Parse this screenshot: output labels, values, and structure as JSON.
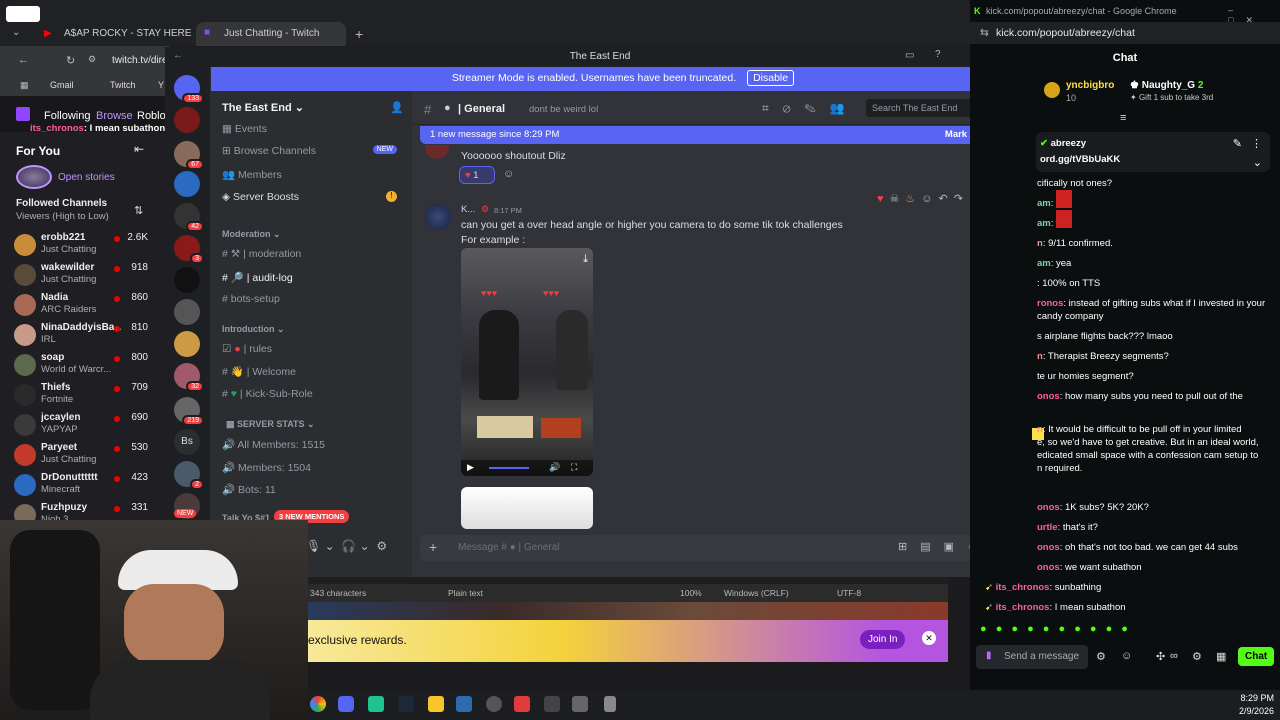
{
  "twitch_browser": {
    "tabs": [
      {
        "label": "A$AP ROCKY - STAY HERE 4 LIF"
      },
      {
        "label": "Just Chatting - Twitch"
      }
    ],
    "url": "twitch.tv/dire",
    "bookmarks": [
      "Gmail",
      "Twitch",
      "Y"
    ],
    "nav": {
      "following": "Following",
      "browse": "Browse",
      "roblox": "Roblo"
    },
    "chat_overlay": {
      "user": "its_chronos",
      "text": ": I mean subathon"
    }
  },
  "twitch_sidebar": {
    "title": "For You",
    "open_stories": "Open stories",
    "followed_title": "Followed Channels",
    "followed_sub": "Viewers (High to Low)",
    "channels": [
      {
        "name": "erobb221",
        "game": "Just Chatting",
        "viewers": "2.6K",
        "color": "#c98c3a"
      },
      {
        "name": "wakewilder",
        "game": "Just Chatting",
        "viewers": "918",
        "color": "#5a4a3a"
      },
      {
        "name": "Nadia",
        "game": "ARC Raiders",
        "viewers": "860",
        "color": "#a86a55"
      },
      {
        "name": "NinaDaddyisBa...",
        "game": "IRL",
        "viewers": "810",
        "color": "#c79a8a"
      },
      {
        "name": "soap",
        "game": "World of Warcr...",
        "viewers": "800",
        "color": "#5a6a4a"
      },
      {
        "name": "Thiefs",
        "game": "Fortnite",
        "viewers": "709",
        "color": "#2a2a2a"
      },
      {
        "name": "jccaylen",
        "game": "YAPYAP",
        "viewers": "690",
        "color": "#3a3a3a"
      },
      {
        "name": "Paryeet",
        "game": "Just Chatting",
        "viewers": "530",
        "color": "#c33a2a"
      },
      {
        "name": "DrDonutttttt",
        "game": "Minecraft",
        "viewers": "423",
        "color": "#2a6ac0"
      },
      {
        "name": "Fuzhpuzy",
        "game": "Nioh 3",
        "viewers": "331",
        "color": "#7a6a5a"
      }
    ]
  },
  "discord": {
    "window_title": "The East End",
    "banner_text": "Streamer Mode is enabled. Usernames have been truncated.",
    "banner_button": "Disable",
    "server_name": "The East End",
    "guild_badges": [
      "133",
      "67",
      "42",
      "3",
      "32",
      "219",
      "2"
    ],
    "guild_bs": "Bs",
    "guild_new": "NEW",
    "channels_top": [
      {
        "label": "Events"
      },
      {
        "label": "Browse Channels",
        "badge": "NEW"
      },
      {
        "label": "Members"
      },
      {
        "label": "Server Boosts"
      }
    ],
    "categories": {
      "moderation": "Moderation",
      "introduction": "Introduction",
      "server_stats": "SERVER STATS",
      "talk": "Talk Yo $#1"
    },
    "mod_channels": [
      "moderation",
      "audit-log",
      "bots-setup"
    ],
    "intro_channels": [
      "rules",
      "Welcome",
      "Kick-Sub-Role"
    ],
    "stats_channels": [
      "All Members: 1515",
      "Members: 1504",
      "Bots: 11"
    ],
    "mentions_pill": "3 NEW MENTIONS",
    "header": {
      "channel": "General",
      "topic": "dont be weird lol",
      "search_placeholder": "Search The East End"
    },
    "new_messages": {
      "text": "1 new message since 8:29 PM",
      "action": "Mark As Read"
    },
    "messages": {
      "prev_text": "Yoooooo shoutout Dliz",
      "reaction_count": "1",
      "author": "K...",
      "time": "8:17 PM",
      "line1": "can you get a over head angle or higher you camera to do some tik tok challenges",
      "line2": "For example :"
    },
    "composer_placeholder": "Message #",
    "composer_channel": "General"
  },
  "editor_status": {
    "chars": "343 characters",
    "mode": "Plain text",
    "zoom": "100%",
    "eol": "Windows (CRLF)",
    "enc": "UTF-8"
  },
  "kick_promo": {
    "text": "exclusive rewards.",
    "button": "Join In"
  },
  "kick_browser": {
    "tab_title": "kick.com/popout/abreezy/chat - Google Chrome",
    "url": "kick.com/popout/abreezy/chat",
    "chat_title": "Chat",
    "top_gifter_1": {
      "name": "yncbigbro",
      "count": "10"
    },
    "top_gifter_2": {
      "name": "Naughty_G",
      "count": "2",
      "note": "Gift 1 sub to take 3rd"
    },
    "pinned": {
      "user": "abreezy",
      "text": "ord.gg/tVBbUaKK"
    },
    "chat": [
      {
        "name": "",
        "text": "cifically not ones?",
        "color": "#dddddd"
      },
      {
        "name": "am",
        "text": ":",
        "color": "#7dd3a8"
      },
      {
        "name": "am",
        "text": ":",
        "color": "#7dd3a8"
      },
      {
        "name": "n",
        "text": ": 9/11 confirmed.",
        "color": "#ff8c8c"
      },
      {
        "name": "am",
        "text": ": yea",
        "color": "#7dd3a8"
      },
      {
        "name": "",
        "text": ": 100% on TTS",
        "color": "#dddddd"
      },
      {
        "name": "ronos",
        "text": ": instead of gifting subs what if I invested in your",
        "color": "#ff5ea0"
      },
      {
        "name": "",
        "text": "candy company",
        "color": "#dddddd"
      },
      {
        "name": "",
        "text": "s airplane flights back??? lmaoo",
        "color": "#dddddd"
      },
      {
        "name": "n",
        "text": ": Therapist Breezy segments?",
        "color": "#ff8c8c"
      },
      {
        "name": "",
        "text": "te ur homies segment?",
        "color": "#dddddd"
      },
      {
        "name": "onos",
        "text": ": how many subs you need to pull out of the",
        "color": "#ff5ea0"
      },
      {
        "name": "n",
        "text": ": It would be difficult to be pull off in your limited",
        "color": "#ff8c8c"
      },
      {
        "name": "",
        "text": "e, so we'd have to get creative. But in an ideal world,",
        "color": "#dddddd"
      },
      {
        "name": "",
        "text": "edicated small space with a confession cam setup to",
        "color": "#dddddd"
      },
      {
        "name": "",
        "text": "n required.",
        "color": "#dddddd"
      },
      {
        "name": "onos",
        "text": ": 1K subs? 5K? 20K?",
        "color": "#ff5ea0"
      },
      {
        "name": "urtle",
        "text": ": that's it?",
        "color": "#ff5ea0"
      },
      {
        "name": "onos",
        "text": ": oh that's not too bad. we can get 44 subs",
        "color": "#ff5ea0"
      },
      {
        "name": "onos",
        "text": ": we want subathon",
        "color": "#ff5ea0"
      },
      {
        "name": "its_chronos",
        "text": ": sunbathing",
        "color": "#ff5ea0"
      },
      {
        "name": "its_chronos",
        "text": ": I mean subathon",
        "color": "#ff5ea0"
      }
    ],
    "send_placeholder": "Send a message",
    "chat_button": "Chat"
  },
  "taskbar": {
    "time": "8:29 PM",
    "date": "2/9/2026"
  }
}
